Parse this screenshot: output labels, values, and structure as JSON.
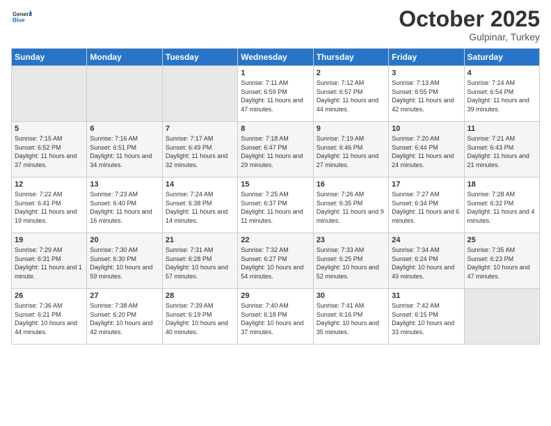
{
  "logo": {
    "line1": "General",
    "line2": "Blue"
  },
  "title": "October 2025",
  "subtitle": "Gulpinar, Turkey",
  "weekdays": [
    "Sunday",
    "Monday",
    "Tuesday",
    "Wednesday",
    "Thursday",
    "Friday",
    "Saturday"
  ],
  "weeks": [
    [
      {
        "day": "",
        "info": ""
      },
      {
        "day": "",
        "info": ""
      },
      {
        "day": "",
        "info": ""
      },
      {
        "day": "1",
        "info": "Sunrise: 7:11 AM\nSunset: 6:59 PM\nDaylight: 11 hours and 47 minutes."
      },
      {
        "day": "2",
        "info": "Sunrise: 7:12 AM\nSunset: 6:57 PM\nDaylight: 11 hours and 44 minutes."
      },
      {
        "day": "3",
        "info": "Sunrise: 7:13 AM\nSunset: 6:55 PM\nDaylight: 11 hours and 42 minutes."
      },
      {
        "day": "4",
        "info": "Sunrise: 7:14 AM\nSunset: 6:54 PM\nDaylight: 11 hours and 39 minutes."
      }
    ],
    [
      {
        "day": "5",
        "info": "Sunrise: 7:15 AM\nSunset: 6:52 PM\nDaylight: 11 hours and 37 minutes."
      },
      {
        "day": "6",
        "info": "Sunrise: 7:16 AM\nSunset: 6:51 PM\nDaylight: 11 hours and 34 minutes."
      },
      {
        "day": "7",
        "info": "Sunrise: 7:17 AM\nSunset: 6:49 PM\nDaylight: 11 hours and 32 minutes."
      },
      {
        "day": "8",
        "info": "Sunrise: 7:18 AM\nSunset: 6:47 PM\nDaylight: 11 hours and 29 minutes."
      },
      {
        "day": "9",
        "info": "Sunrise: 7:19 AM\nSunset: 6:46 PM\nDaylight: 11 hours and 27 minutes."
      },
      {
        "day": "10",
        "info": "Sunrise: 7:20 AM\nSunset: 6:44 PM\nDaylight: 11 hours and 24 minutes."
      },
      {
        "day": "11",
        "info": "Sunrise: 7:21 AM\nSunset: 6:43 PM\nDaylight: 11 hours and 21 minutes."
      }
    ],
    [
      {
        "day": "12",
        "info": "Sunrise: 7:22 AM\nSunset: 6:41 PM\nDaylight: 11 hours and 19 minutes."
      },
      {
        "day": "13",
        "info": "Sunrise: 7:23 AM\nSunset: 6:40 PM\nDaylight: 11 hours and 16 minutes."
      },
      {
        "day": "14",
        "info": "Sunrise: 7:24 AM\nSunset: 6:38 PM\nDaylight: 11 hours and 14 minutes."
      },
      {
        "day": "15",
        "info": "Sunrise: 7:25 AM\nSunset: 6:37 PM\nDaylight: 11 hours and 11 minutes."
      },
      {
        "day": "16",
        "info": "Sunrise: 7:26 AM\nSunset: 6:35 PM\nDaylight: 11 hours and 9 minutes."
      },
      {
        "day": "17",
        "info": "Sunrise: 7:27 AM\nSunset: 6:34 PM\nDaylight: 11 hours and 6 minutes."
      },
      {
        "day": "18",
        "info": "Sunrise: 7:28 AM\nSunset: 6:32 PM\nDaylight: 11 hours and 4 minutes."
      }
    ],
    [
      {
        "day": "19",
        "info": "Sunrise: 7:29 AM\nSunset: 6:31 PM\nDaylight: 11 hours and 1 minute."
      },
      {
        "day": "20",
        "info": "Sunrise: 7:30 AM\nSunset: 6:30 PM\nDaylight: 10 hours and 59 minutes."
      },
      {
        "day": "21",
        "info": "Sunrise: 7:31 AM\nSunset: 6:28 PM\nDaylight: 10 hours and 57 minutes."
      },
      {
        "day": "22",
        "info": "Sunrise: 7:32 AM\nSunset: 6:27 PM\nDaylight: 10 hours and 54 minutes."
      },
      {
        "day": "23",
        "info": "Sunrise: 7:33 AM\nSunset: 6:25 PM\nDaylight: 10 hours and 52 minutes."
      },
      {
        "day": "24",
        "info": "Sunrise: 7:34 AM\nSunset: 6:24 PM\nDaylight: 10 hours and 49 minutes."
      },
      {
        "day": "25",
        "info": "Sunrise: 7:35 AM\nSunset: 6:23 PM\nDaylight: 10 hours and 47 minutes."
      }
    ],
    [
      {
        "day": "26",
        "info": "Sunrise: 7:36 AM\nSunset: 6:21 PM\nDaylight: 10 hours and 44 minutes."
      },
      {
        "day": "27",
        "info": "Sunrise: 7:38 AM\nSunset: 6:20 PM\nDaylight: 10 hours and 42 minutes."
      },
      {
        "day": "28",
        "info": "Sunrise: 7:39 AM\nSunset: 6:19 PM\nDaylight: 10 hours and 40 minutes."
      },
      {
        "day": "29",
        "info": "Sunrise: 7:40 AM\nSunset: 6:18 PM\nDaylight: 10 hours and 37 minutes."
      },
      {
        "day": "30",
        "info": "Sunrise: 7:41 AM\nSunset: 6:16 PM\nDaylight: 10 hours and 35 minutes."
      },
      {
        "day": "31",
        "info": "Sunrise: 7:42 AM\nSunset: 6:15 PM\nDaylight: 10 hours and 33 minutes."
      },
      {
        "day": "",
        "info": ""
      }
    ]
  ]
}
